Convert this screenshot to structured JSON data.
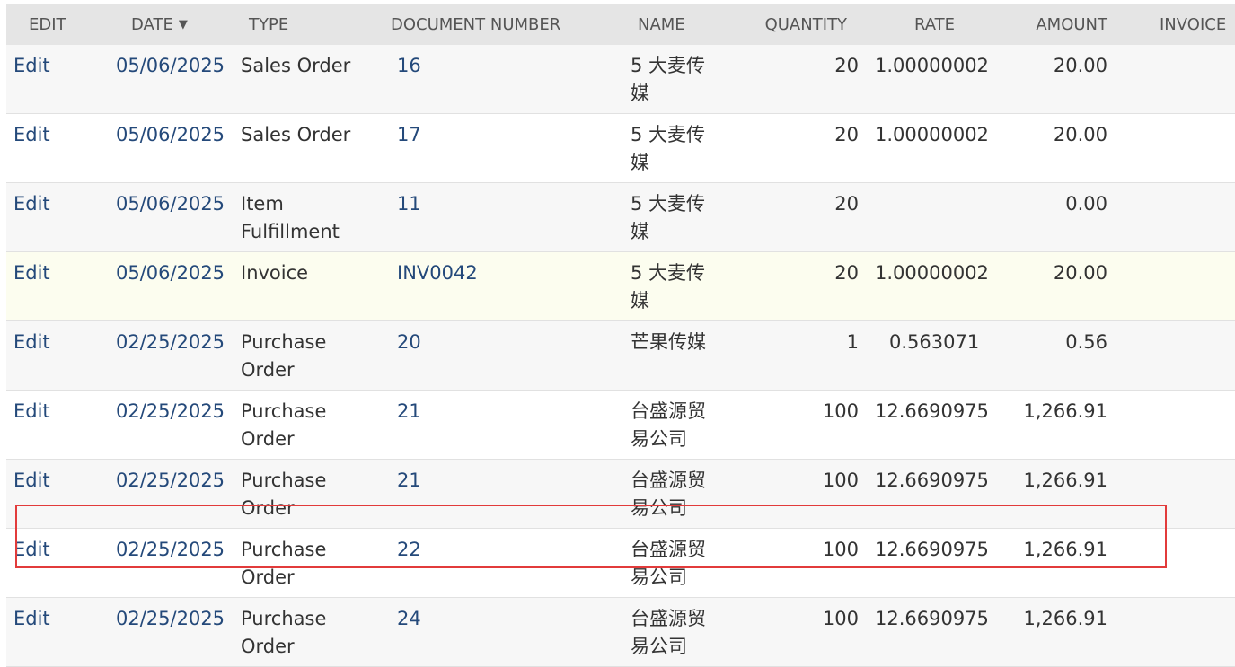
{
  "columns": {
    "edit": "EDIT",
    "date": "DATE",
    "type": "TYPE",
    "document_number": "DOCUMENT NUMBER",
    "name": "NAME",
    "quantity": "QUANTITY",
    "rate": "RATE",
    "amount": "AMOUNT",
    "invoice": "INVOICE"
  },
  "sort_indicator": "▼",
  "rows": [
    {
      "edit": "Edit",
      "date": "05/06/2025",
      "type": "Sales Order",
      "doc": "16",
      "name": "5 大麦传媒",
      "qty": "20",
      "rate": "1.00000002",
      "amount": "20.00"
    },
    {
      "edit": "Edit",
      "date": "05/06/2025",
      "type": "Sales Order",
      "doc": "17",
      "name": "5 大麦传媒",
      "qty": "20",
      "rate": "1.00000002",
      "amount": "20.00"
    },
    {
      "edit": "Edit",
      "date": "05/06/2025",
      "type": "Item Fulfillment",
      "doc": "11",
      "name": "5 大麦传媒",
      "qty": "20",
      "rate": "",
      "amount": "0.00"
    },
    {
      "edit": "Edit",
      "date": "05/06/2025",
      "type": "Invoice",
      "doc": "INV0042",
      "name": "5 大麦传媒",
      "qty": "20",
      "rate": "1.00000002",
      "amount": "20.00"
    },
    {
      "edit": "Edit",
      "date": "02/25/2025",
      "type": "Purchase Order",
      "doc": "20",
      "name": "芒果传媒",
      "qty": "1",
      "rate": "0.563071",
      "amount": "0.56"
    },
    {
      "edit": "Edit",
      "date": "02/25/2025",
      "type": "Purchase Order",
      "doc": "21",
      "name": "台盛源贸易公司",
      "qty": "100",
      "rate": "12.6690975",
      "amount": "1,266.91"
    },
    {
      "edit": "Edit",
      "date": "02/25/2025",
      "type": "Purchase Order",
      "doc": "21",
      "name": "台盛源贸易公司",
      "qty": "100",
      "rate": "12.6690975",
      "amount": "1,266.91"
    },
    {
      "edit": "Edit",
      "date": "02/25/2025",
      "type": "Purchase Order",
      "doc": "22",
      "name": "台盛源贸易公司",
      "qty": "100",
      "rate": "12.6690975",
      "amount": "1,266.91"
    },
    {
      "edit": "Edit",
      "date": "02/25/2025",
      "type": "Purchase Order",
      "doc": "24",
      "name": "台盛源贸易公司",
      "qty": "100",
      "rate": "12.6690975",
      "amount": "1,266.91"
    }
  ]
}
